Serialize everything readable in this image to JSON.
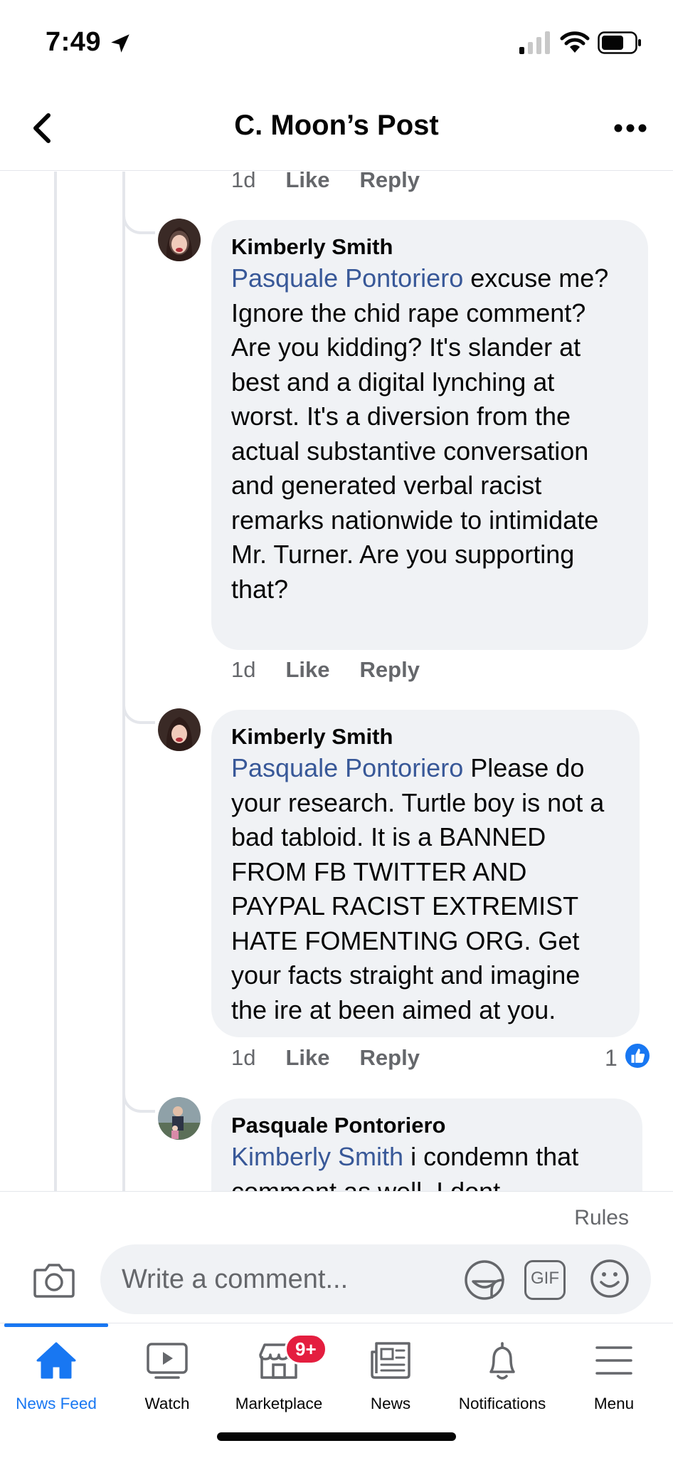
{
  "status_bar": {
    "time": "7:49"
  },
  "header": {
    "title": "C. Moon’s Post"
  },
  "thread": {
    "top_actions": {
      "time": "1d",
      "like": "Like",
      "reply": "Reply"
    },
    "comments": [
      {
        "author": "Kimberly Smith",
        "mention": "Pasquale Pontoriero",
        "text": " excuse me? Ignore the chid rape comment? Are you kidding? It's slander at best and a digital lynching at worst.  It's a diversion from the actual substantive conversation and generated verbal racist remarks nationwide to intimidate Mr. Turner. Are you supporting that?",
        "time": "1d",
        "like": "Like",
        "reply": "Reply"
      },
      {
        "author": "Kimberly Smith",
        "mention": "Pasquale Pontoriero",
        "text": " Please do your research. Turtle boy is not a bad tabloid. It is a BANNED FROM FB TWITTER AND PAYPAL RACIST EXTREMIST HATE FOMENTING ORG.  Get your facts straight and imagine the ire at been aimed at you.",
        "time": "1d",
        "like": "Like",
        "reply": "Reply",
        "reaction_count": "1"
      },
      {
        "author": "Pasquale Pontoriero",
        "mention": "Kimberly Smith",
        "text": " i condemn that comment as well.  I dont"
      }
    ]
  },
  "composer": {
    "rules": "Rules",
    "placeholder": "Write a comment...",
    "gif_label": "GIF"
  },
  "tabs": [
    {
      "label": "News Feed",
      "icon": "home-icon",
      "active": true
    },
    {
      "label": "Watch",
      "icon": "watch-icon"
    },
    {
      "label": "Marketplace",
      "icon": "marketplace-icon",
      "badge": "9+"
    },
    {
      "label": "News",
      "icon": "news-icon"
    },
    {
      "label": "Notifications",
      "icon": "bell-icon"
    },
    {
      "label": "Menu",
      "icon": "menu-icon"
    }
  ],
  "colors": {
    "link": "#385898",
    "accent": "#1877f2",
    "bubble": "#f0f2f5",
    "meta": "#65676b",
    "badge": "#e41e3f"
  }
}
